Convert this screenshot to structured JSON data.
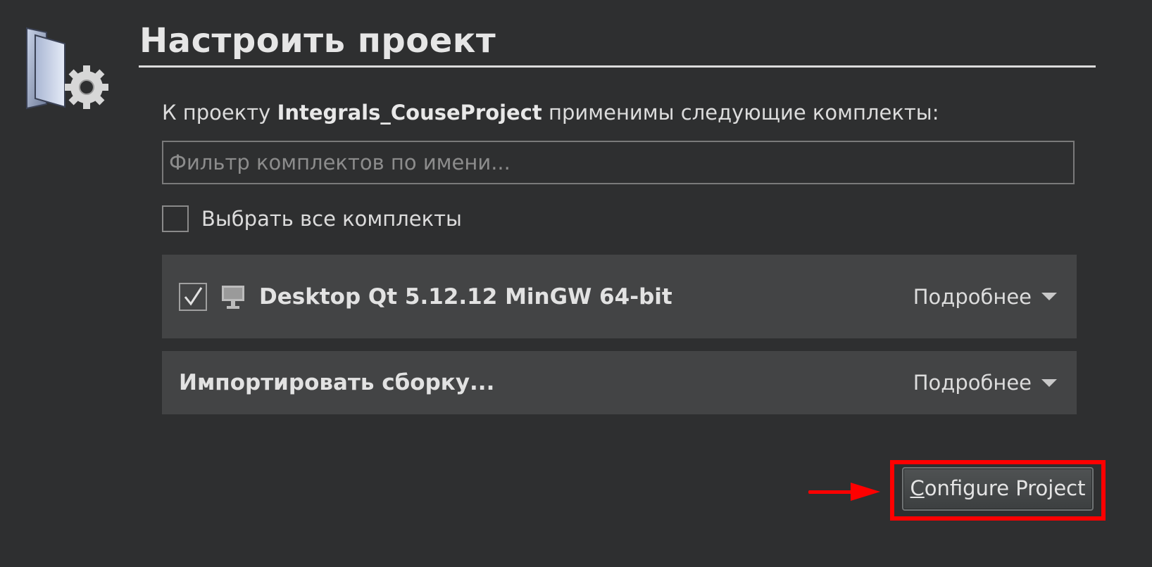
{
  "page": {
    "title": "Настроить проект",
    "intro_prefix": "К проекту",
    "project_name": "Integrals_CouseProject",
    "intro_suffix": "применимы следующие комплекты:"
  },
  "filter": {
    "placeholder": "Фильтр комплектов по имени..."
  },
  "select_all": {
    "label": "Выбрать все комплекты",
    "checked": false
  },
  "kits": [
    {
      "name": "Desktop Qt 5.12.12 MinGW 64-bit",
      "checked": true,
      "icon": "monitor-icon",
      "details_label": "Подробнее"
    },
    {
      "name": "Импортировать сборку...",
      "details_label": "Подробнее"
    }
  ],
  "configure_button": {
    "mnemonic": "C",
    "label_rest": "onfigure Project"
  },
  "colors": {
    "background": "#2e2f30",
    "panel": "#434445",
    "highlight": "#ff0000",
    "text": "#dcdcdc"
  }
}
